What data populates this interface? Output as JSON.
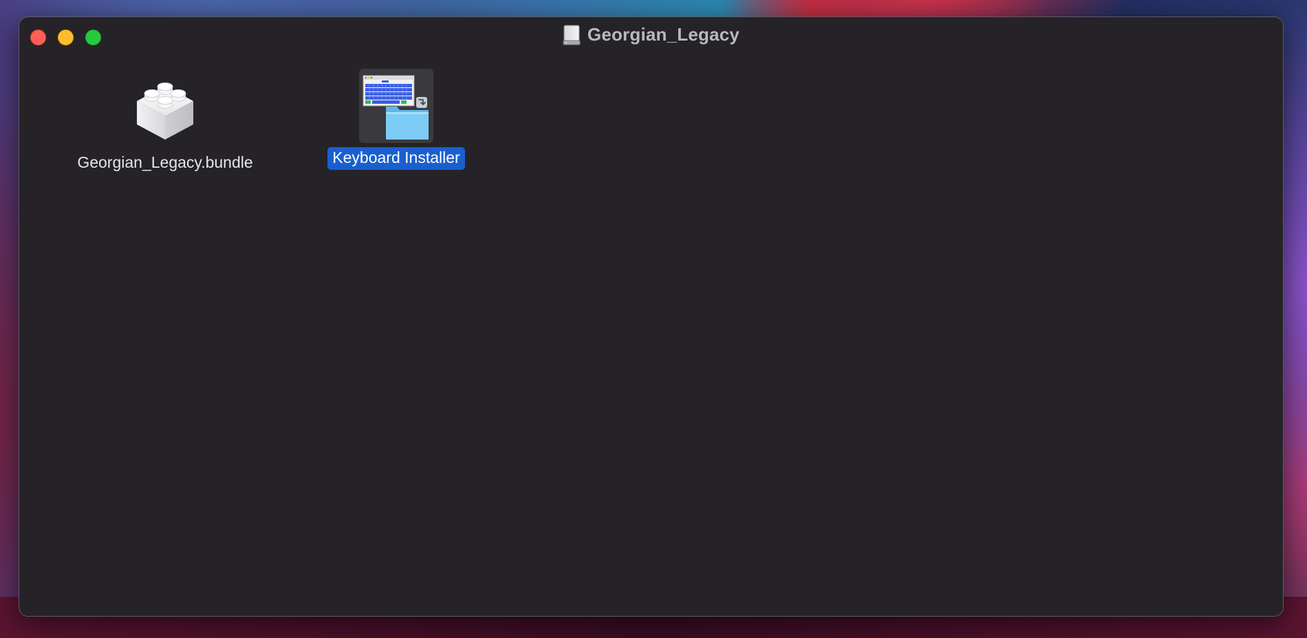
{
  "window": {
    "title": "Georgian_Legacy",
    "title_icon": "external-disk-icon"
  },
  "traffic_lights": {
    "close": "#ff5f57",
    "minimize": "#febc2e",
    "maximize": "#28c840"
  },
  "items": [
    {
      "name": "Georgian_Legacy.bundle",
      "icon": "lego-brick-bundle-icon",
      "selected": false
    },
    {
      "name": "Keyboard Installer",
      "icon": "keyboard-installer-icon",
      "selected": true
    }
  ],
  "colors": {
    "window_background": "#252327",
    "selection_highlight": "#1a5fd0",
    "folder_blue": "#6fc3f0"
  }
}
